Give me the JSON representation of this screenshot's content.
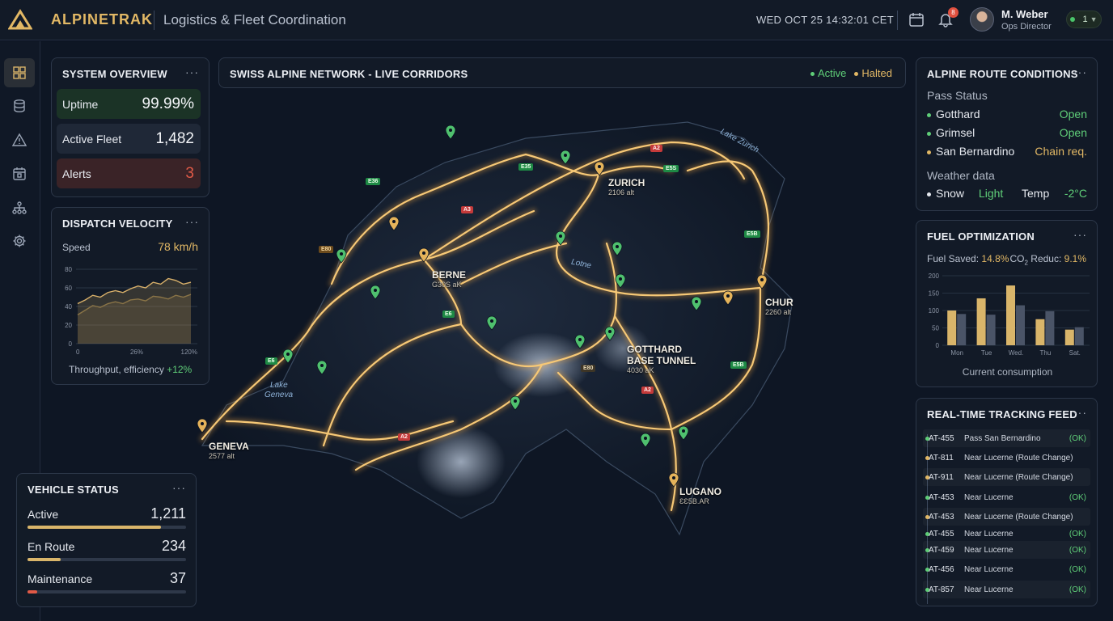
{
  "app": {
    "brand": "ALPINETRAK",
    "subtitle": "Logistics & Fleet Coordination",
    "datetime": "WED OCT 25 14:32:01 CET",
    "notifications": "8",
    "user_name": "M. Weber",
    "user_role": "Ops Director",
    "status_count": "1"
  },
  "colors": {
    "accent": "#e2b865",
    "ok": "#5fce78",
    "alert": "#e05a47",
    "route": "#f0b450"
  },
  "icons": {
    "logo": "alpinetrak-logo",
    "calendar": "calendar-icon",
    "bell": "bell-icon",
    "sidebar": [
      "dashboard-icon",
      "database-icon",
      "warning-icon",
      "calendar-icon",
      "network-icon",
      "settings-icon"
    ]
  },
  "system_overview": {
    "title": "SYSTEM OVERVIEW",
    "menu": "···",
    "uptime_label": "Uptime",
    "uptime": "99.99%",
    "fleet_label": "Active Fleet",
    "fleet": "1,482",
    "alerts_label": "Alerts",
    "alerts": "3"
  },
  "dispatch": {
    "title": "DISPATCH VELOCITY",
    "menu": "···",
    "speed_label": "Speed",
    "speed": "78 km/h",
    "footer": "Throughput, efficiency",
    "footer_delta": "+12%"
  },
  "dispatch_chart": {
    "type": "area",
    "y_ticks": [
      "80",
      "60",
      "40",
      "20",
      "0"
    ],
    "x_ticks": [
      "0",
      "26%",
      "120%"
    ],
    "ylim": [
      0,
      80
    ],
    "series": [
      {
        "values": [
          43,
          47,
          52,
          50,
          55,
          57,
          55,
          59,
          62,
          60,
          66,
          64,
          70,
          68,
          64,
          66
        ]
      },
      {
        "values": [
          31,
          36,
          41,
          39,
          43,
          45,
          43,
          47,
          48,
          46,
          51,
          50,
          48,
          52,
          50,
          53
        ]
      }
    ]
  },
  "map": {
    "title": "SWISS ALPINE NETWORK - LIVE CORRIDORS",
    "legend_active": "Active",
    "legend_halted": "Halted",
    "cities": [
      {
        "name": "ZURICH",
        "alt": "2106 alt"
      },
      {
        "name": "BERNE",
        "alt": "G30S aK"
      },
      {
        "name": "CHUR",
        "alt": "2260 alt"
      },
      {
        "name": "GOTTHARD",
        "name2": "BASE TUNNEL",
        "alt": "4030 aK"
      },
      {
        "name": "GENEVA",
        "alt": "2577 alt"
      },
      {
        "name": "LUGANO",
        "alt": "ƐƐ5B.AR"
      }
    ],
    "lakes": [
      "Lake Zurich",
      "Lake",
      "Geneva",
      "Lotne"
    ],
    "road_chips": [
      "A2",
      "E5S",
      "E35",
      "E36",
      "A3",
      "E80",
      "E6",
      "E6",
      "A2",
      "E5B",
      "E5B",
      "A2",
      "E80"
    ]
  },
  "vehicle_status": {
    "title": "VEHICLE STATUS",
    "menu": "···",
    "items": [
      {
        "label": "Active",
        "value": "1,211",
        "fill": 0.84
      },
      {
        "label": "En Route",
        "value": "234",
        "fill": 0.21
      },
      {
        "label": "Maintenance",
        "value": "37",
        "fill": 0.06
      }
    ]
  },
  "route_conditions": {
    "title": "ALPINE ROUTE CONDITIONS",
    "menu": "···",
    "pass_label": "Pass Status",
    "passes": [
      {
        "name": "Gotthard",
        "status": "Open"
      },
      {
        "name": "Grimsel",
        "status": "Open"
      },
      {
        "name": "San Bernardino",
        "status": "Chain req."
      }
    ],
    "weather_label": "Weather data",
    "snow_label": "Snow",
    "snow": "Light",
    "temp_label": "Temp",
    "temp": "-2°C"
  },
  "fuel": {
    "title": "FUEL OPTIMIZATION",
    "menu": "···",
    "saved_label": "Fuel Saved:",
    "saved": "14.8%",
    "co2_label": "CO",
    "co2_sub": "2",
    "co2_label2": " Reduc:",
    "co2": "9.1%",
    "footer": "Current consumption"
  },
  "fuel_chart": {
    "type": "bar",
    "categories": [
      "Mon",
      "Tue",
      "Wed.",
      "Thu",
      "Sat."
    ],
    "y_ticks": [
      "200",
      "150",
      "100",
      "50",
      "0"
    ],
    "ylim": [
      0,
      200
    ],
    "series": [
      {
        "values": [
          100,
          135,
          172,
          75,
          45
        ]
      },
      {
        "values": [
          90,
          88,
          115,
          98,
          52
        ]
      }
    ]
  },
  "tracking": {
    "title": "REAL-TIME TRACKING FEED",
    "menu": "···",
    "rows": [
      {
        "id": "AT-455",
        "loc": "Pass San Bernardino",
        "status": "(OK)"
      },
      {
        "id": "AT-811",
        "loc": "Near Lucerne (Route Change)",
        "status": ""
      },
      {
        "id": "AT-911",
        "loc": "Near Lucerne (Route Change)",
        "status": ""
      },
      {
        "id": "AT-453",
        "loc": "Near Lucerne",
        "status": "(OK)"
      },
      {
        "id": "AT-453",
        "loc": "Near Lucerne (Route Change)",
        "status": ""
      },
      {
        "id": "AT-455",
        "loc": "Near Lucerne",
        "status": "(OK)"
      },
      {
        "id": "AT-459",
        "loc": "Near Lucerne",
        "status": "(OK)"
      },
      {
        "id": "AT-456",
        "loc": "Near Lucerne",
        "status": "(OK)"
      },
      {
        "id": "AT-857",
        "loc": "Near Lucerne",
        "status": "(OK)"
      }
    ]
  }
}
